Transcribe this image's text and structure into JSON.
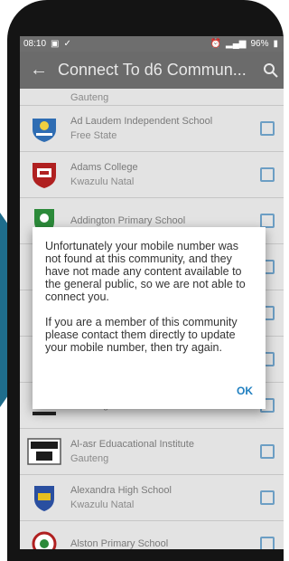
{
  "status_bar": {
    "time": "08:10",
    "battery": "96%"
  },
  "app_bar": {
    "title": "Connect To d6 Commun..."
  },
  "list": {
    "partial_province": "Gauteng",
    "items": [
      {
        "name": "Ad Laudem Independent School",
        "province": "Free State"
      },
      {
        "name": "Adams College",
        "province": "Kwazulu Natal"
      },
      {
        "name": "Addington Primary School",
        "province": ""
      },
      {
        "name": "",
        "province": ""
      },
      {
        "name": "",
        "province": ""
      },
      {
        "name": "",
        "province": ""
      },
      {
        "name": "",
        "province": "Gauteng"
      },
      {
        "name": "Al-asr Eduacational Institute",
        "province": "Gauteng"
      },
      {
        "name": "Alexandra High School",
        "province": "Kwazulu Natal"
      },
      {
        "name": "Alston Primary School",
        "province": ""
      }
    ]
  },
  "dialog": {
    "message_1": "Unfortunately your mobile number was not found at this community, and they have not made any content available to the general public, so we are not able to connect you.",
    "message_2": "If you are a member of this community please contact them directly to update your mobile number, then try again.",
    "ok_label": "OK"
  }
}
